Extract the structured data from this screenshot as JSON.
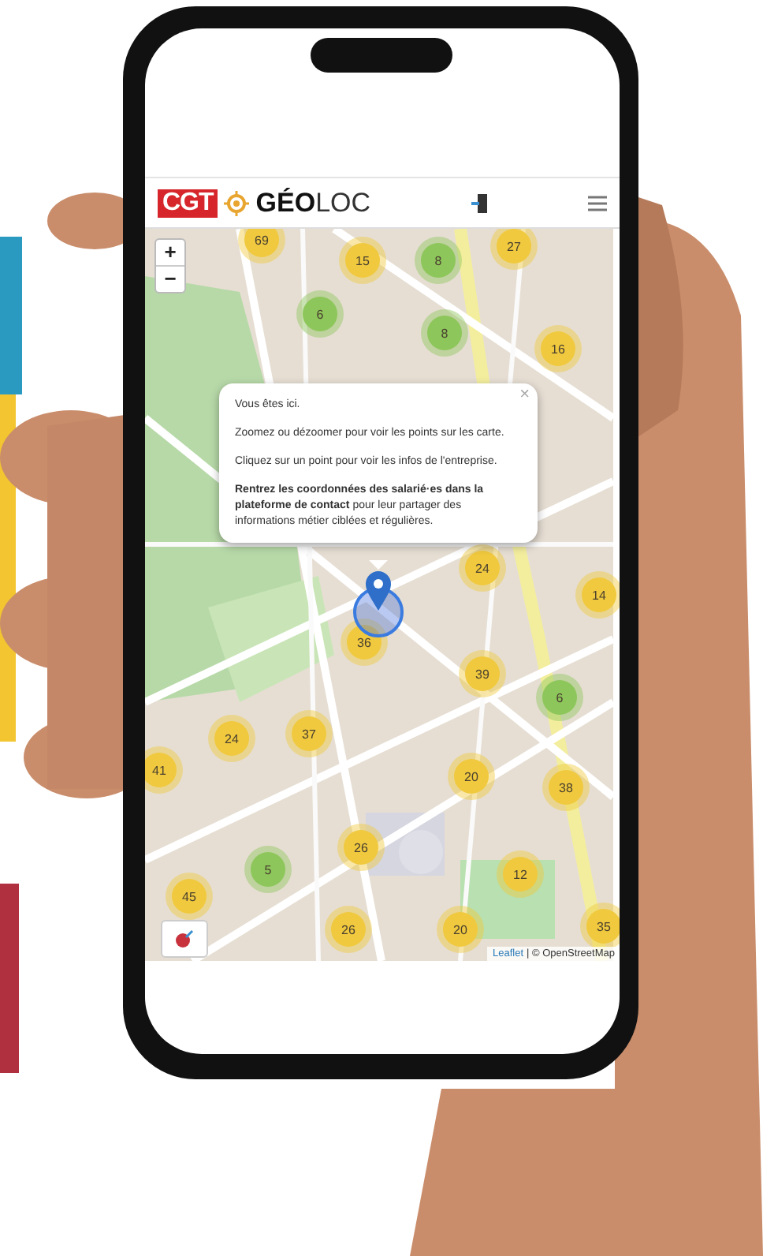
{
  "header": {
    "logo": {
      "badge": "CGT",
      "bold": "GÉO",
      "light": "LOC"
    }
  },
  "map": {
    "zoom_in": "+",
    "zoom_out": "−",
    "clusters": [
      {
        "count": "69",
        "color": "#f0c93e"
      },
      {
        "count": "15",
        "color": "#f0c93e"
      },
      {
        "count": "8",
        "color": "#8dc65a"
      },
      {
        "count": "27",
        "color": "#f0c93e"
      },
      {
        "count": "6",
        "color": "#8dc65a"
      },
      {
        "count": "8",
        "color": "#8dc65a"
      },
      {
        "count": "16",
        "color": "#f0c93e"
      },
      {
        "count": "24",
        "color": "#f0c93e"
      },
      {
        "count": "14",
        "color": "#f0c93e"
      },
      {
        "count": "36",
        "color": "#f0c93e"
      },
      {
        "count": "39",
        "color": "#f0c93e"
      },
      {
        "count": "6",
        "color": "#8dc65a"
      },
      {
        "count": "24",
        "color": "#f0c93e"
      },
      {
        "count": "37",
        "color": "#f0c93e"
      },
      {
        "count": "41",
        "color": "#f0c93e"
      },
      {
        "count": "20",
        "color": "#f0c93e"
      },
      {
        "count": "38",
        "color": "#f0c93e"
      },
      {
        "count": "26",
        "color": "#f0c93e"
      },
      {
        "count": "5",
        "color": "#8dc65a"
      },
      {
        "count": "12",
        "color": "#f0c93e"
      },
      {
        "count": "45",
        "color": "#f0c93e"
      },
      {
        "count": "26",
        "color": "#f0c93e"
      },
      {
        "count": "20",
        "color": "#f0c93e"
      },
      {
        "count": "35",
        "color": "#f0c93e"
      }
    ],
    "popup": {
      "close": "×",
      "paragraphs": [
        "Vous êtes ici.",
        "Zoomez ou dézoomer pour voir les points sur les carte.",
        "Cliquez sur un point pour voir les infos de l'entreprise.",
        "**Rentrez les coordonnées des salarié·es dans la plateforme de contact** pour leur partager des informations métier ciblées et régulières."
      ]
    },
    "attribution": {
      "link": "Leaflet",
      "text": "| © OpenStreetMap"
    }
  }
}
